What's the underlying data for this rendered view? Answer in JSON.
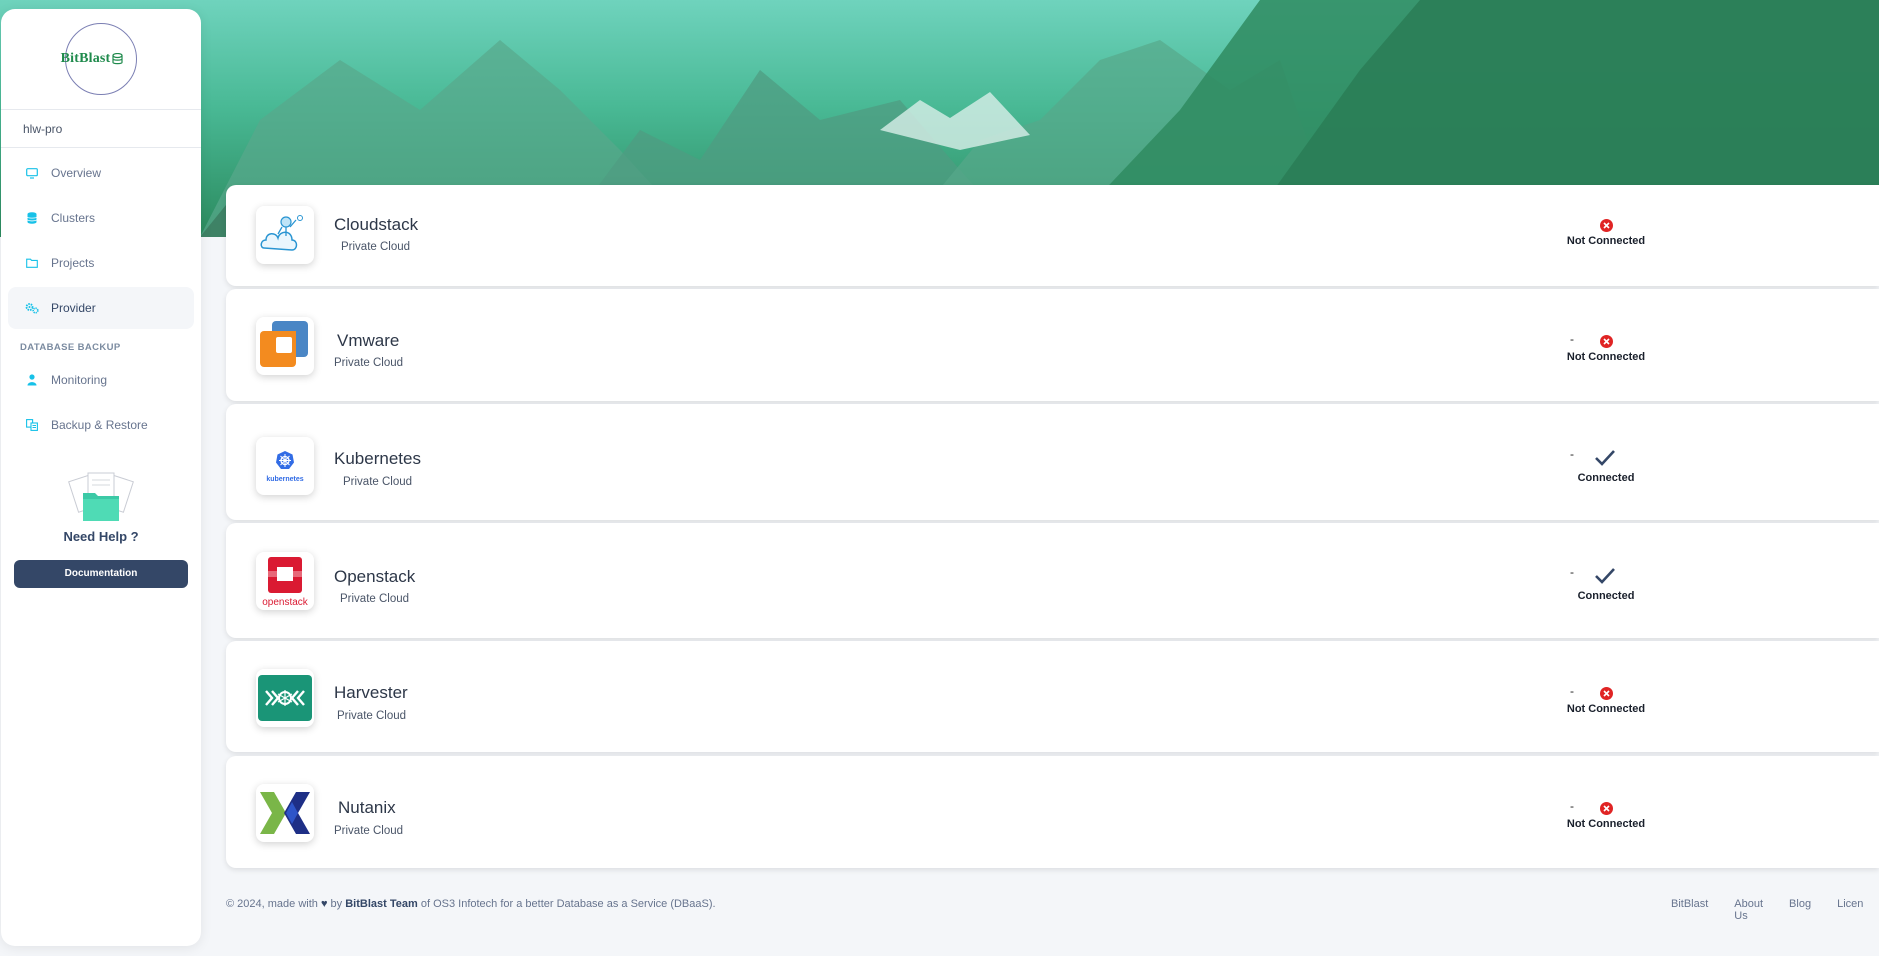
{
  "sidebar": {
    "logo_text": "BitBlast",
    "project_name": "hlw-pro",
    "nav": [
      {
        "label": "Overview",
        "icon": "monitor-icon"
      },
      {
        "label": "Clusters",
        "icon": "database-icon"
      },
      {
        "label": "Projects",
        "icon": "folder-icon"
      },
      {
        "label": "Provider",
        "icon": "gears-icon",
        "active": true
      }
    ],
    "section_title": "DATABASE BACKUP",
    "backup_nav": [
      {
        "label": "Monitoring",
        "icon": "user-icon"
      },
      {
        "label": "Backup & Restore",
        "icon": "backup-icon"
      }
    ],
    "help_title": "Need Help ?",
    "doc_button": "Documentation"
  },
  "providers": [
    {
      "name": "Cloudstack",
      "type": "Private Cloud",
      "dash": "",
      "status": "Not Connected",
      "connected": false
    },
    {
      "name": "Vmware",
      "type": "Private Cloud",
      "dash": "-",
      "status": "Not Connected",
      "connected": false
    },
    {
      "name": "Kubernetes",
      "type": "Private Cloud",
      "dash": "-",
      "status": "Connected",
      "connected": true
    },
    {
      "name": "Openstack",
      "type": "Private Cloud",
      "dash": "-",
      "status": "Connected",
      "connected": true
    },
    {
      "name": "Harvester",
      "type": "Private Cloud",
      "dash": "-",
      "status": "Not Connected",
      "connected": false
    },
    {
      "name": "Nutanix",
      "type": "Private Cloud",
      "dash": "-",
      "status": "Not Connected",
      "connected": false
    }
  ],
  "kubernetes_logo_text": "kubernetes",
  "openstack_logo_text": "openstack",
  "footer": {
    "copy_prefix": "© 2024, made with",
    "copy_by": "by",
    "team": "BitBlast Team",
    "copy_suffix": "of OS3 Infotech for a better Database as a Service (DBaaS).",
    "links": [
      "BitBlast",
      "About Us",
      "Blog",
      "Licen"
    ]
  },
  "colors": {
    "accent": "#17c1e8",
    "dark": "#344767",
    "error": "#e02424",
    "hero_green": "#2b8a5e"
  }
}
